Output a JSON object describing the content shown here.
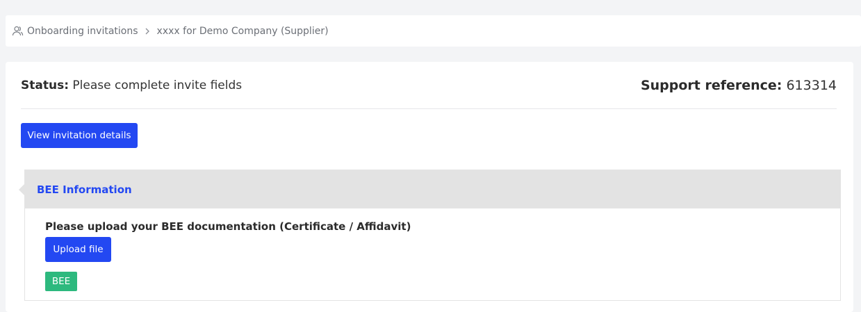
{
  "breadcrumb": {
    "icon": "users-icon",
    "root_label": "Onboarding invitations",
    "separator_icon": "chevron-right-icon",
    "current_label": "xxxx for Demo Company (Supplier)"
  },
  "status": {
    "label": "Status:",
    "value": "Please complete invite fields"
  },
  "support": {
    "label": "Support reference:",
    "value": "613314"
  },
  "actions": {
    "view_invitation_label": "View invitation details"
  },
  "bee_section": {
    "title": "BEE Information",
    "upload_prompt": "Please upload your BEE documentation (Certificate / Affidavit)",
    "upload_button_label": "Upload file",
    "badge_label": "BEE"
  },
  "colors": {
    "primary": "#2348f2",
    "success": "#2db97e",
    "section_header_bg": "#e3e3e3",
    "page_bg": "#f3f4f6"
  }
}
